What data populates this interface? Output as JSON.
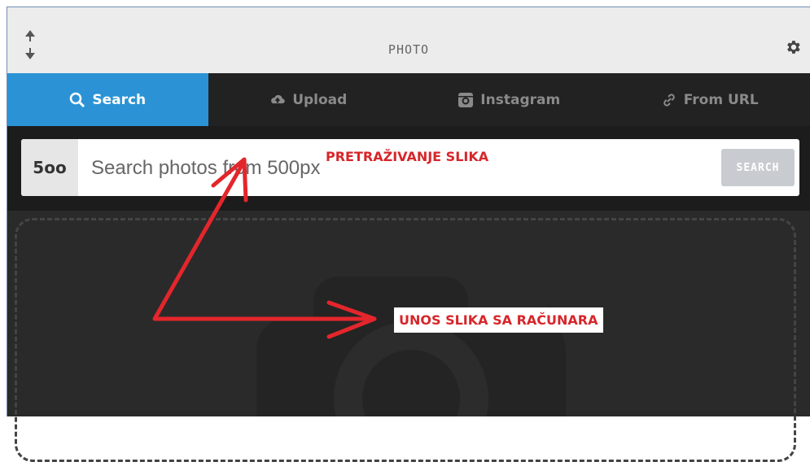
{
  "header": {
    "title": "PHOTO"
  },
  "tabs": [
    {
      "label": "Search",
      "icon": "search-icon",
      "active": true
    },
    {
      "label": "Upload",
      "icon": "cloud-upload-icon",
      "active": false
    },
    {
      "label": "Instagram",
      "icon": "instagram-icon",
      "active": false
    },
    {
      "label": "From URL",
      "icon": "link-icon",
      "active": false
    }
  ],
  "search": {
    "logo": "5oo",
    "placeholder": "Search photos from 500px",
    "button_label": "SEARCH"
  },
  "annotations": {
    "search_note": "PRETRAŽIVANJE SLIKA",
    "upload_note": "UNOS SLIKA SA RAČUNARA"
  },
  "colors": {
    "active_tab": "#2b93d5",
    "annotation": "#d6262a",
    "panel_bg": "#2a2a2a"
  }
}
